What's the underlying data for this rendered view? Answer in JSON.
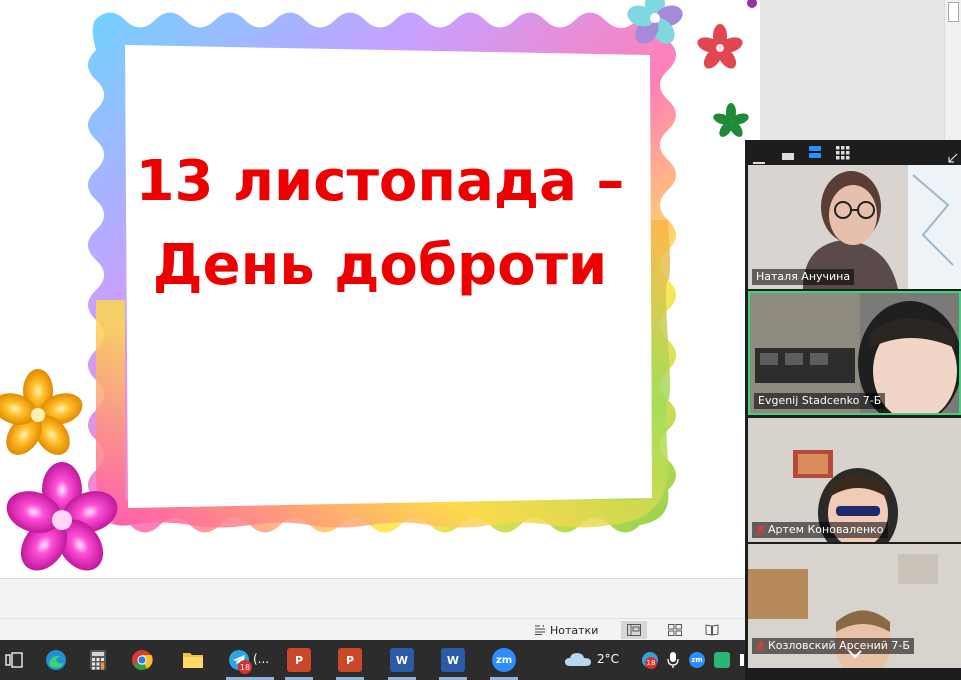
{
  "slide": {
    "title_line1": "13 листопада –",
    "title_line2": "День доброти"
  },
  "statusbar": {
    "notes_label": "Нотатки"
  },
  "taskbar": {
    "telegram_label": "(...",
    "telegram_badge": "18",
    "weather_temp": "2°C",
    "tray_badge": "18"
  },
  "zoom": {
    "participants": [
      {
        "name": "Наталя Анучина",
        "muted": false,
        "speaking": false
      },
      {
        "name": "Evgenij Stadcenko 7-Б",
        "muted": false,
        "speaking": true
      },
      {
        "name": "Артем Коноваленко",
        "muted": true,
        "speaking": false
      },
      {
        "name": "Козловский Арсений 7-Б",
        "muted": true,
        "speaking": false
      }
    ]
  },
  "colors": {
    "title_red": "#ee0000",
    "taskbar_bg": "#2c2c2c",
    "zoom_bg": "#1d1d1d",
    "speaking_border": "#3fd37a"
  }
}
